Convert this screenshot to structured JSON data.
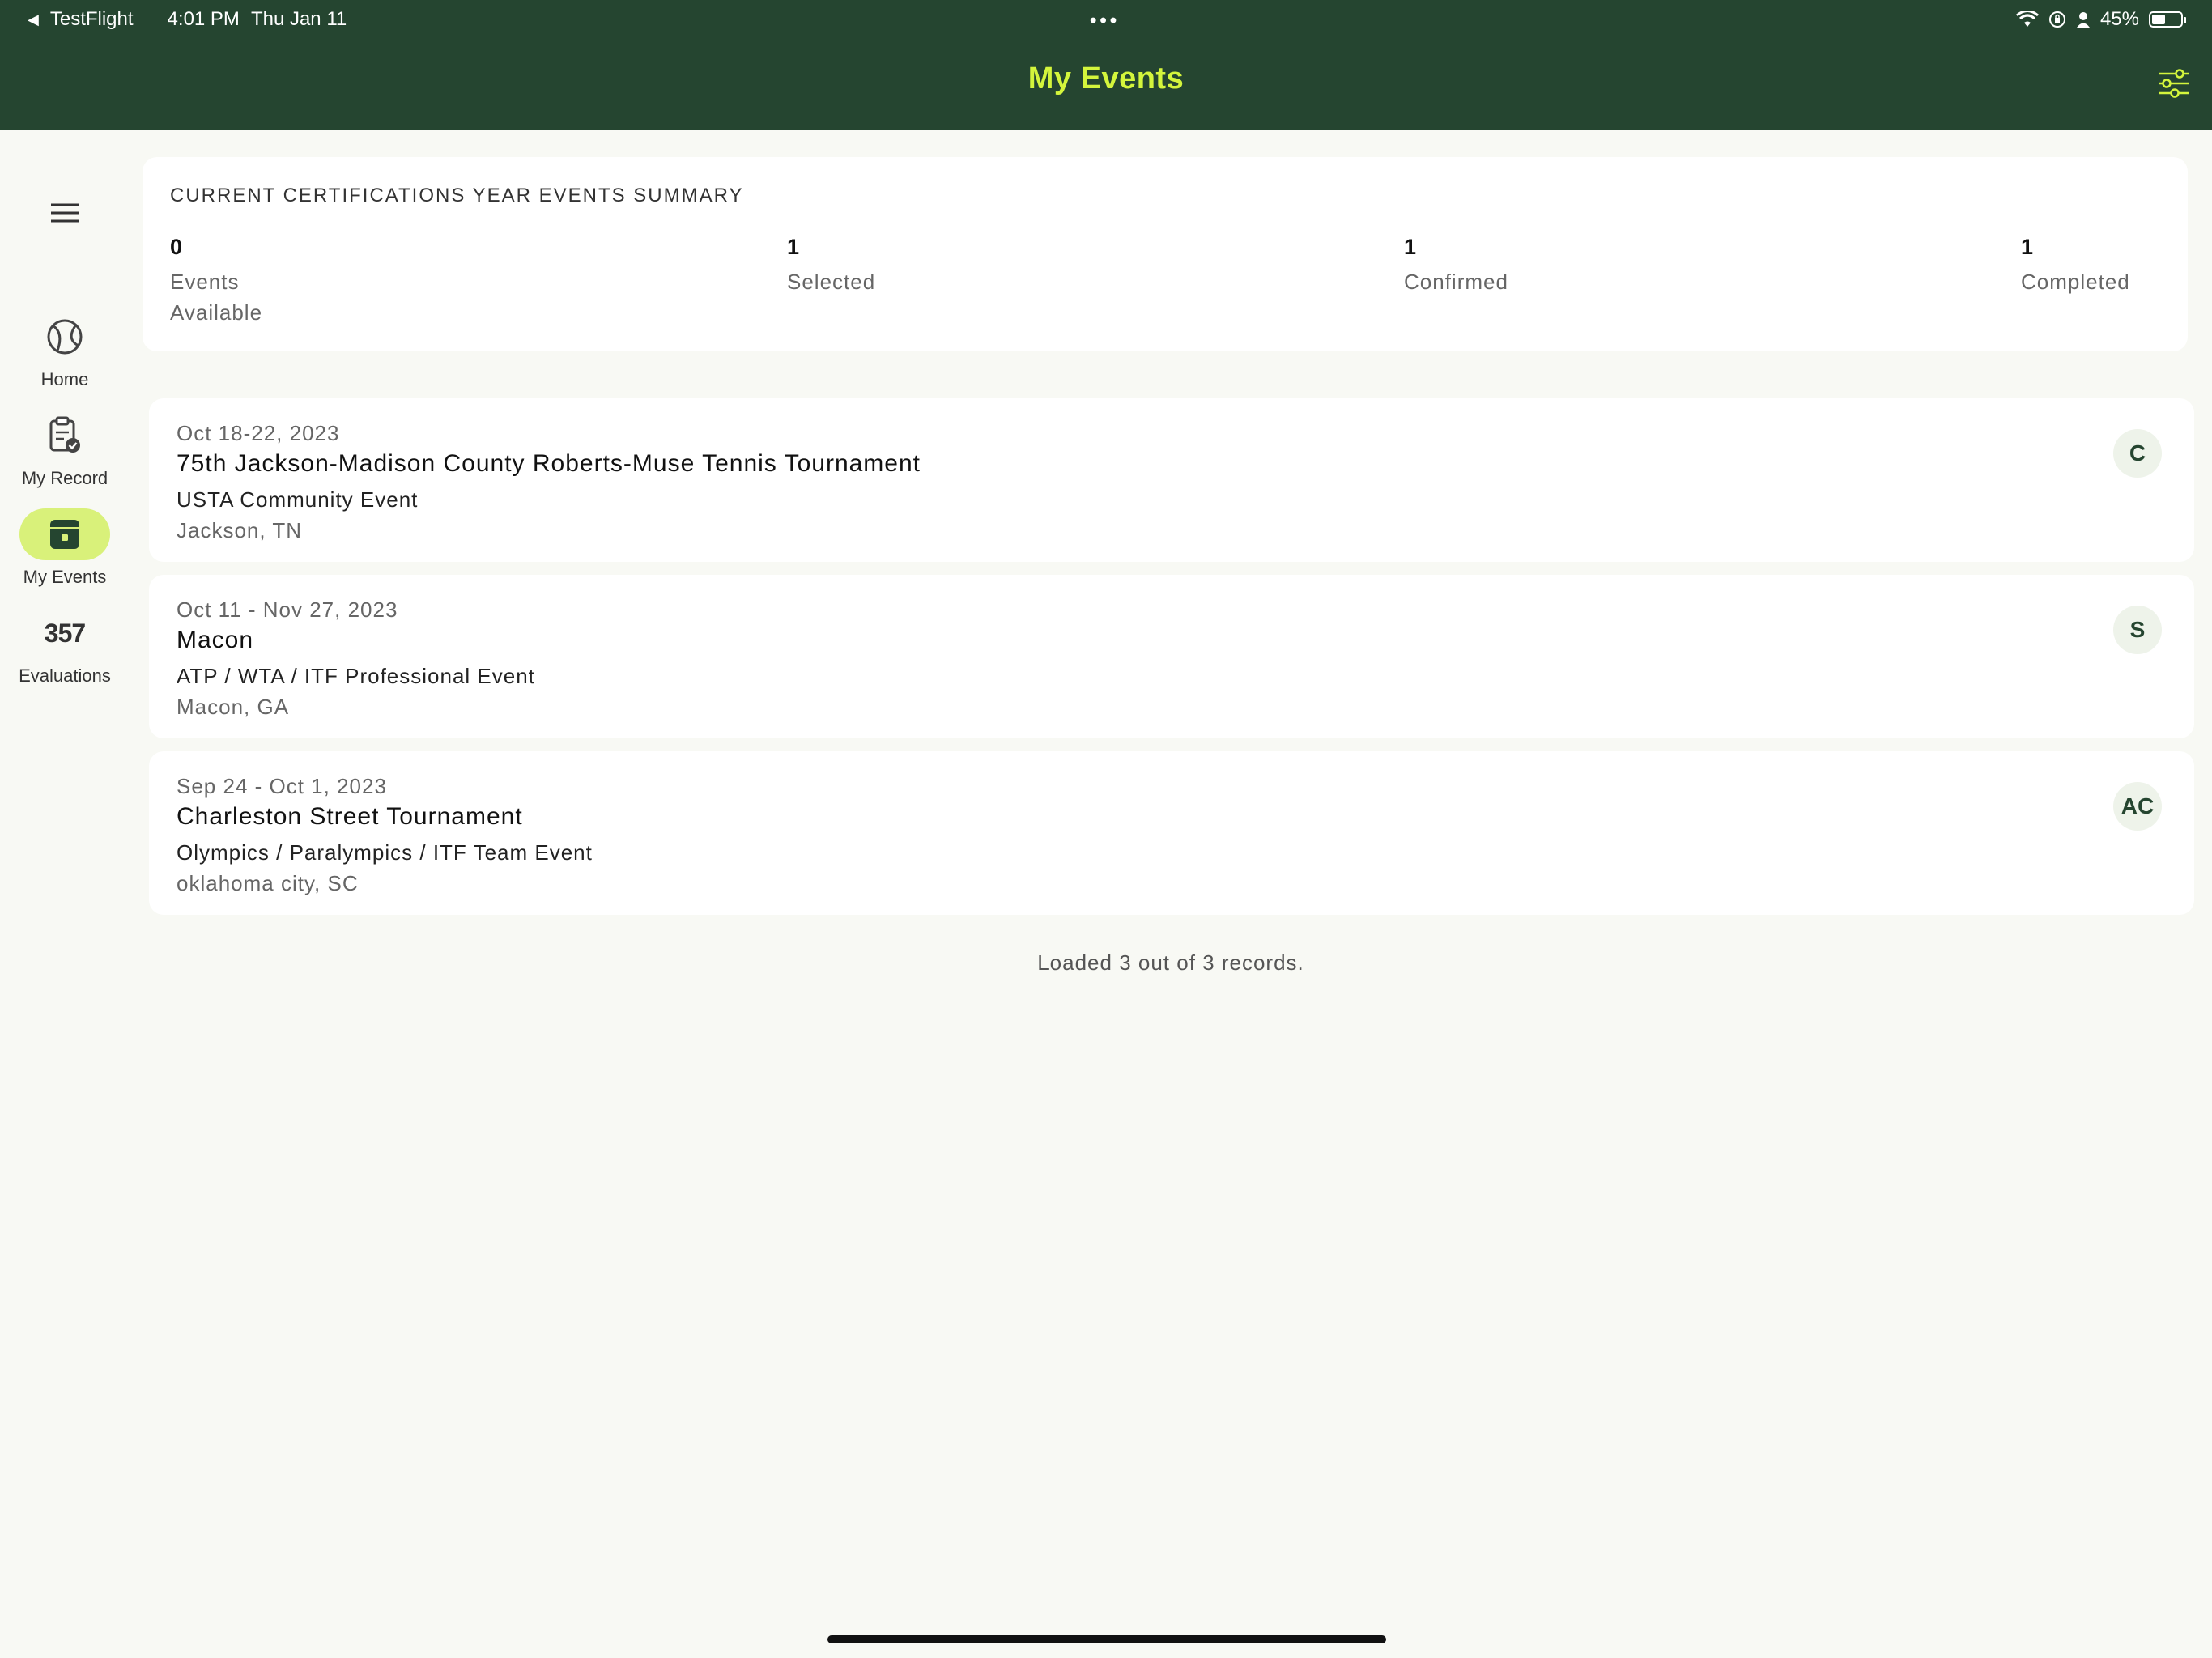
{
  "status_bar": {
    "back_app": "TestFlight",
    "time": "4:01 PM",
    "date": "Thu Jan 11",
    "dots": "•••",
    "battery": "45%"
  },
  "header": {
    "title": "My Events"
  },
  "nav": {
    "items": [
      {
        "label": "Home",
        "icon": "tennis-ball-icon"
      },
      {
        "label": "My Record",
        "icon": "clipboard-check-icon"
      },
      {
        "label": "My Events",
        "icon": "event-box-icon",
        "active": true
      },
      {
        "label": "Evaluations",
        "icon": "numbers-icon",
        "icon_text": "357"
      }
    ]
  },
  "summary": {
    "title": "CURRENT CERTIFICATIONS YEAR EVENTS SUMMARY",
    "stats": [
      {
        "value": "0",
        "label": "Events Available"
      },
      {
        "value": "1",
        "label": "Selected"
      },
      {
        "value": "1",
        "label": "Confirmed"
      },
      {
        "value": "1",
        "label": "Completed"
      }
    ]
  },
  "events": [
    {
      "date": "Oct 18-22, 2023",
      "name": "75th Jackson-Madison County Roberts-Muse Tennis Tournament",
      "type": "USTA Community Event",
      "location": "Jackson, TN",
      "badge": "C"
    },
    {
      "date": "Oct 11 - Nov 27, 2023",
      "name": "Macon",
      "type": "ATP / WTA / ITF Professional Event",
      "location": "Macon, GA",
      "badge": "S"
    },
    {
      "date": "Sep 24 - Oct 1, 2023",
      "name": "Charleston Street Tournament",
      "type": "Olympics / Paralympics / ITF Team Event",
      "location": "oklahoma city, SC",
      "badge": "AC"
    }
  ],
  "footer": {
    "loaded_text": "Loaded 3 out of 3 records."
  },
  "colors": {
    "header_bg": "#254530",
    "accent": "#d4f53c",
    "active_nav": "#d9f17a",
    "page_bg": "#f8f9f4"
  }
}
